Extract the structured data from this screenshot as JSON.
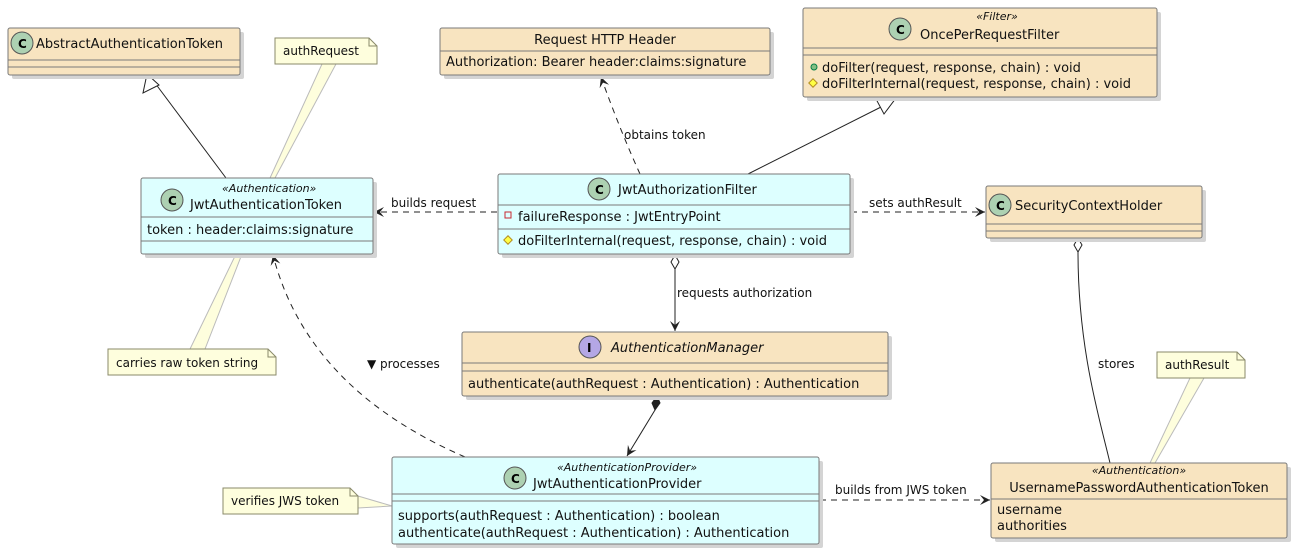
{
  "classes": {
    "abstract_token": {
      "name": "AbstractAuthenticationToken",
      "kind": "C"
    },
    "jwt_token": {
      "stereotype": "«Authentication»",
      "name": "JwtAuthenticationToken",
      "kind": "C",
      "attributes": [
        "token : header:claims:signature"
      ]
    },
    "http_header": {
      "name": "Request HTTP Header",
      "attributes": [
        "Authorization: Bearer header:claims:signature"
      ]
    },
    "once_filter": {
      "stereotype": "«Filter»",
      "name": "OncePerRequestFilter",
      "kind": "C",
      "methods": [
        "doFilter(request, response, chain) : void",
        "doFilterInternal(request, response, chain) : void"
      ]
    },
    "jwt_filter": {
      "name": "JwtAuthorizationFilter",
      "kind": "C",
      "attributes": [
        "failureResponse : JwtEntryPoint"
      ],
      "methods": [
        "doFilterInternal(request, response, chain) : void"
      ]
    },
    "context_holder": {
      "name": "SecurityContextHolder",
      "kind": "C"
    },
    "auth_manager": {
      "name": "AuthenticationManager",
      "kind": "I",
      "methods": [
        "authenticate(authRequest : Authentication) : Authentication"
      ]
    },
    "jwt_provider": {
      "stereotype": "«AuthenticationProvider»",
      "name": "JwtAuthenticationProvider",
      "kind": "C",
      "methods": [
        "supports(authRequest : Authentication) : boolean",
        "authenticate(authRequest : Authentication) : Authentication"
      ]
    },
    "up_token": {
      "stereotype": "«Authentication»",
      "name": "UsernamePasswordAuthenticationToken",
      "attributes": [
        "username",
        "authorities"
      ]
    }
  },
  "notes": {
    "auth_request": "authRequest",
    "raw_token": "carries raw token string",
    "verifies": "verifies JWS token",
    "auth_result": "authResult"
  },
  "relations": {
    "obtains_token": "obtains token",
    "builds_request": "builds request",
    "sets_auth_result": "sets authResult",
    "requests_authorization": "requests authorization",
    "processes": "▼ processes",
    "stores": "stores",
    "builds_from_jws": "builds from JWS token"
  },
  "colors": {
    "class_fill": "#F8E4C0",
    "highlight_fill": "#DDFFFF",
    "note_fill": "#FEFEDD",
    "class_icon": "#ADD1B2",
    "interface_icon": "#B4A7E5"
  }
}
